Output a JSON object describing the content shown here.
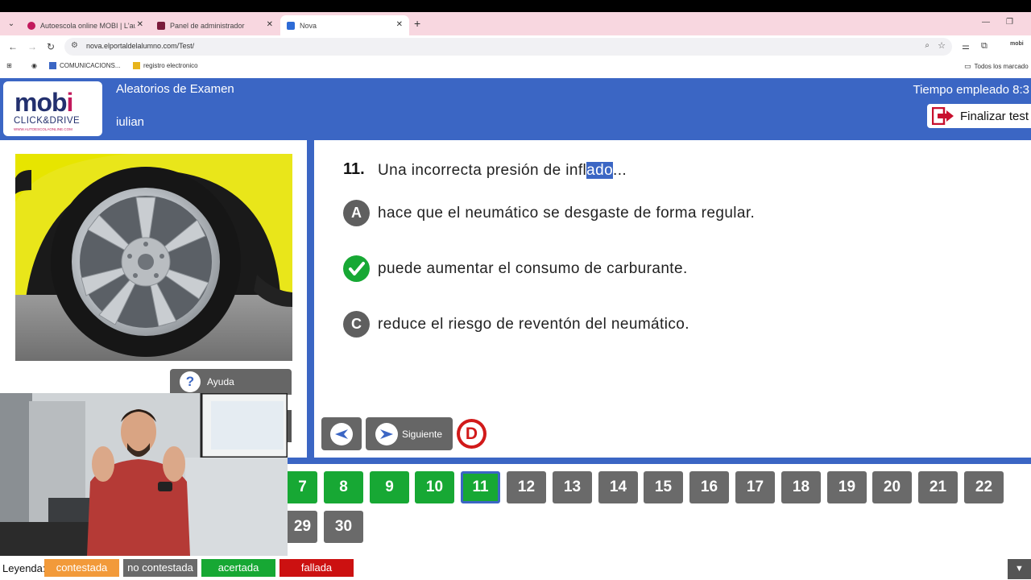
{
  "browser": {
    "tabs": [
      {
        "title": "Autoescola online MOBI | L'auto",
        "fav_color": "#c2195c",
        "active": false
      },
      {
        "title": "Panel de administrador",
        "fav_color": "#7a1a3a",
        "active": false
      },
      {
        "title": "Nova",
        "fav_color": "#2d6bd6",
        "active": true
      }
    ],
    "url": "nova.elportaldelalumno.com/Test/",
    "bookmarks": [
      {
        "label": "COMUNICACIONS..."
      },
      {
        "label": "registro electronico"
      }
    ],
    "all_bookmarks_label": "Todos los marcado"
  },
  "header": {
    "logo_main": "mobi",
    "logo_sub": "CLICK&DRIVE",
    "logo_url": "WWW.AUTOESCOLAONLINE.COM",
    "title": "Aleatorios de Examen",
    "user": "iulian",
    "time": "Tiempo empleado 8:3",
    "finish_label": "Finalizar test"
  },
  "sidebar": {
    "help_label": "Ayuda"
  },
  "question": {
    "number": "11.",
    "text_before": "Una incorrecta presión de infl",
    "text_selected": "ado",
    "text_after": "...",
    "options": [
      {
        "badge": "A",
        "text": "hace que el neumático se desgaste de forma regular.",
        "state": "gray"
      },
      {
        "badge": "✓",
        "text": "puede aumentar el consumo de carburante.",
        "state": "green"
      },
      {
        "badge": "C",
        "text": "reduce el riesgo de reventón del neumático.",
        "state": "gray"
      }
    ]
  },
  "navigation": {
    "next_label": "Siguiente",
    "d_label": "D"
  },
  "question_grid": {
    "row1": [
      {
        "n": "7",
        "state": "green"
      },
      {
        "n": "8",
        "state": "green"
      },
      {
        "n": "9",
        "state": "green"
      },
      {
        "n": "10",
        "state": "green"
      },
      {
        "n": "11",
        "state": "current"
      },
      {
        "n": "12",
        "state": "gray"
      },
      {
        "n": "13",
        "state": "gray"
      },
      {
        "n": "14",
        "state": "gray"
      },
      {
        "n": "15",
        "state": "gray"
      },
      {
        "n": "16",
        "state": "gray"
      },
      {
        "n": "17",
        "state": "gray"
      },
      {
        "n": "18",
        "state": "gray"
      },
      {
        "n": "19",
        "state": "gray"
      },
      {
        "n": "20",
        "state": "gray"
      },
      {
        "n": "21",
        "state": "gray"
      },
      {
        "n": "22",
        "state": "gray"
      }
    ],
    "row2": [
      {
        "n": "29",
        "state": "gray"
      },
      {
        "n": "30",
        "state": "gray"
      }
    ]
  },
  "legend": {
    "label": "Leyenda:",
    "items": [
      {
        "label": "contestada",
        "color": "#f29a3a"
      },
      {
        "label": "no contestada",
        "color": "#6a6a6a"
      },
      {
        "label": "acertada",
        "color": "#17a834"
      },
      {
        "label": "fallada",
        "color": "#cc1111"
      }
    ]
  },
  "colors": {
    "brand_blue": "#3b66c4",
    "green": "#17a834",
    "red": "#d11a1a"
  }
}
